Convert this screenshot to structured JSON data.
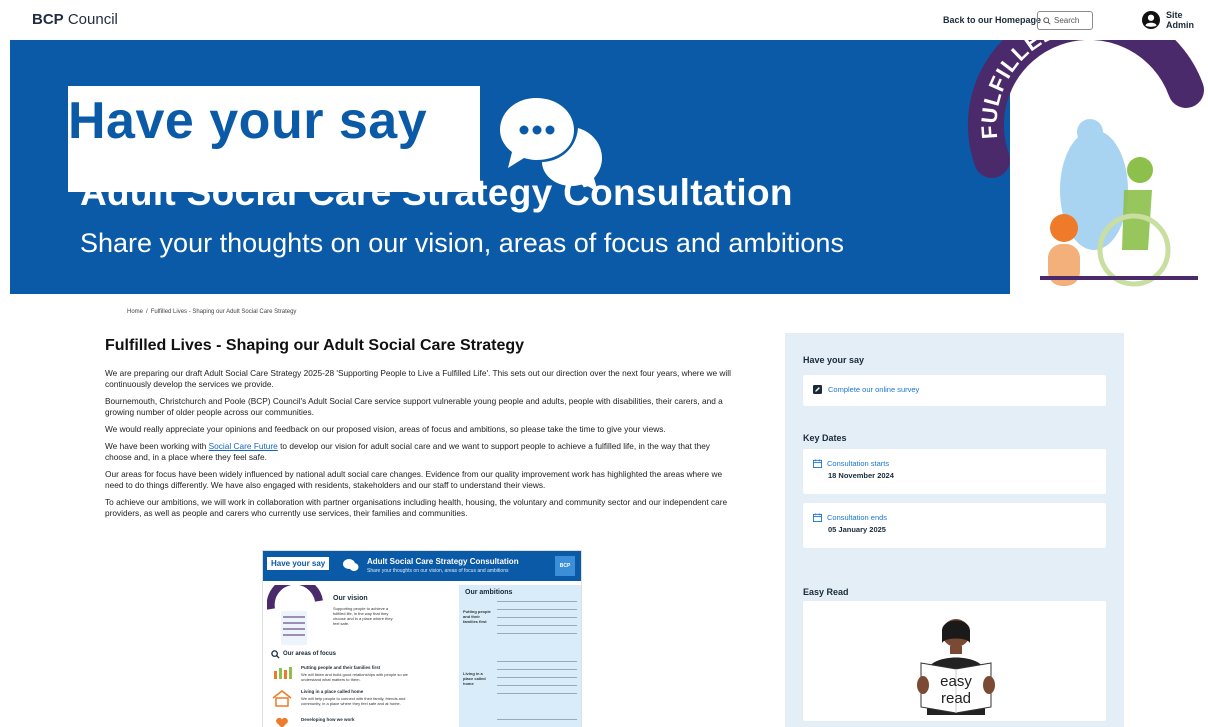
{
  "header": {
    "logo_bold": "BCP",
    "logo_rest": "Council",
    "back_link": "Back to our Homepage",
    "search_placeholder": "Search",
    "user_label": "Site Admin"
  },
  "banner": {
    "headline": "Have your say",
    "title": "Adult Social Care Strategy Consultation",
    "subtitle": "Share your thoughts on our vision, areas of focus and ambitions",
    "badge": "FULFILLED LIVES"
  },
  "breadcrumb": {
    "home": "Home",
    "separator": "/",
    "current": "Fulfilled Lives - Shaping our Adult Social Care Strategy"
  },
  "main": {
    "title": "Fulfilled Lives - Shaping our Adult Social Care Strategy",
    "p1": "We are preparing our draft Adult Social Care Strategy 2025-28 'Supporting People to Live a Fulfilled Life'. This sets out our direction over the next four years, where we will continuously develop the services we provide.",
    "p2": "Bournemouth, Christchurch and Poole (BCP) Council's Adult Social Care service support vulnerable young people and adults, people with disabilities, their carers, and a growing number of older people across our communities.",
    "p3": "We would really appreciate your opinions and feedback on our proposed vision, areas of focus and ambitions, so please take the time to give your views.",
    "p4_before": "We have been working with ",
    "p4_link": "Social Care Future",
    "p4_after": " to develop our vision for adult social care and we want to support people to achieve a fulfilled life, in the way that they choose and, in a place where they feel safe.",
    "p5": "Our areas for focus have been widely influenced by national adult social care changes. Evidence from our quality improvement work has highlighted the areas where we need to do things differently. We have also engaged with residents, stakeholders and our staff to understand their views.",
    "p6": "To achieve our ambitions, we will work in collaboration with partner organisations including health, housing, the voluntary and community sector and our independent care providers, as well as people and carers who currently use services, their families and communities."
  },
  "infographic": {
    "hys": "Have your say",
    "title": "Adult Social Care Strategy Consultation",
    "subtitle": "Share your thoughts on our vision, areas of focus and ambitions",
    "vision_h": "Our vision",
    "vision_t": "Supporting people to achieve a fulfilled life, in the way that they choose and in a place where they feel safe.",
    "focus_h": "Our areas of focus",
    "focus1_h": "Putting people and their families first",
    "focus1_t": "We will listen and build good relationships with people so we understand what matters to them.",
    "focus2_h": "Living in a place called home",
    "focus2_t": "We will help people to connect with their family, friends and community, in a place where they feel safe and at home.",
    "focus3_h": "Developing how we work",
    "ambitions_h": "Our ambitions",
    "amb1": "Putting people and their families first",
    "amb2": "Living in a place called home",
    "badge": "BCP"
  },
  "sidebar": {
    "have_your_say": "Have your say",
    "survey_link": "Complete our online survey",
    "key_dates": "Key Dates",
    "start_label": "Consultation starts",
    "start_date": "18 November 2024",
    "end_label": "Consultation ends",
    "end_date": "05 January 2025",
    "easy_read": "Easy Read",
    "easy_read_line1": "easy",
    "easy_read_line2": "read"
  },
  "colors": {
    "brand_blue": "#0a5aa8",
    "link_blue": "#1976d2",
    "sidebar_bg": "#e3eef7"
  }
}
